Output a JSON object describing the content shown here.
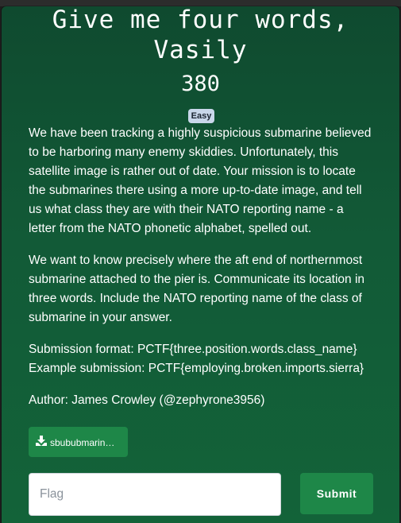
{
  "challenge": {
    "title": "Give me four words,\nVasily",
    "points": "380",
    "difficulty": "Easy",
    "description_p1": [
      "We have been tracking a highly suspicious submarine believed",
      "to be harboring many enemy skiddies. Unfortunately, this",
      "satellite image is rather out of date. Your mission is to locate",
      "the submarines there using a more up-to-date image, and tell",
      "us what class they are with their NATO reporting name - a",
      "letter from the NATO phonetic alphabet, spelled out."
    ],
    "description_p2": [
      "We want to know precisely where the aft end of northernmost",
      "submarine attached to the pier is. Communicate its location in",
      "three words. Include the NATO reporting name of the class of",
      "submarine in your answer."
    ],
    "description_p3": [
      "Submission format: PCTF{three.position.words.class_name}",
      "Example submission: PCTF{employing.broken.imports.sierra}"
    ],
    "author": "Author: James Crowley (@zephyrone3956)",
    "file_label": "sbububmarin…"
  },
  "form": {
    "flag_placeholder": "Flag",
    "submit_label": "Submit"
  },
  "colors": {
    "modal_bg": "#125a37",
    "button": "#1e8748",
    "badge": "#c9d7ea"
  },
  "icons": {
    "download": "download-icon"
  }
}
